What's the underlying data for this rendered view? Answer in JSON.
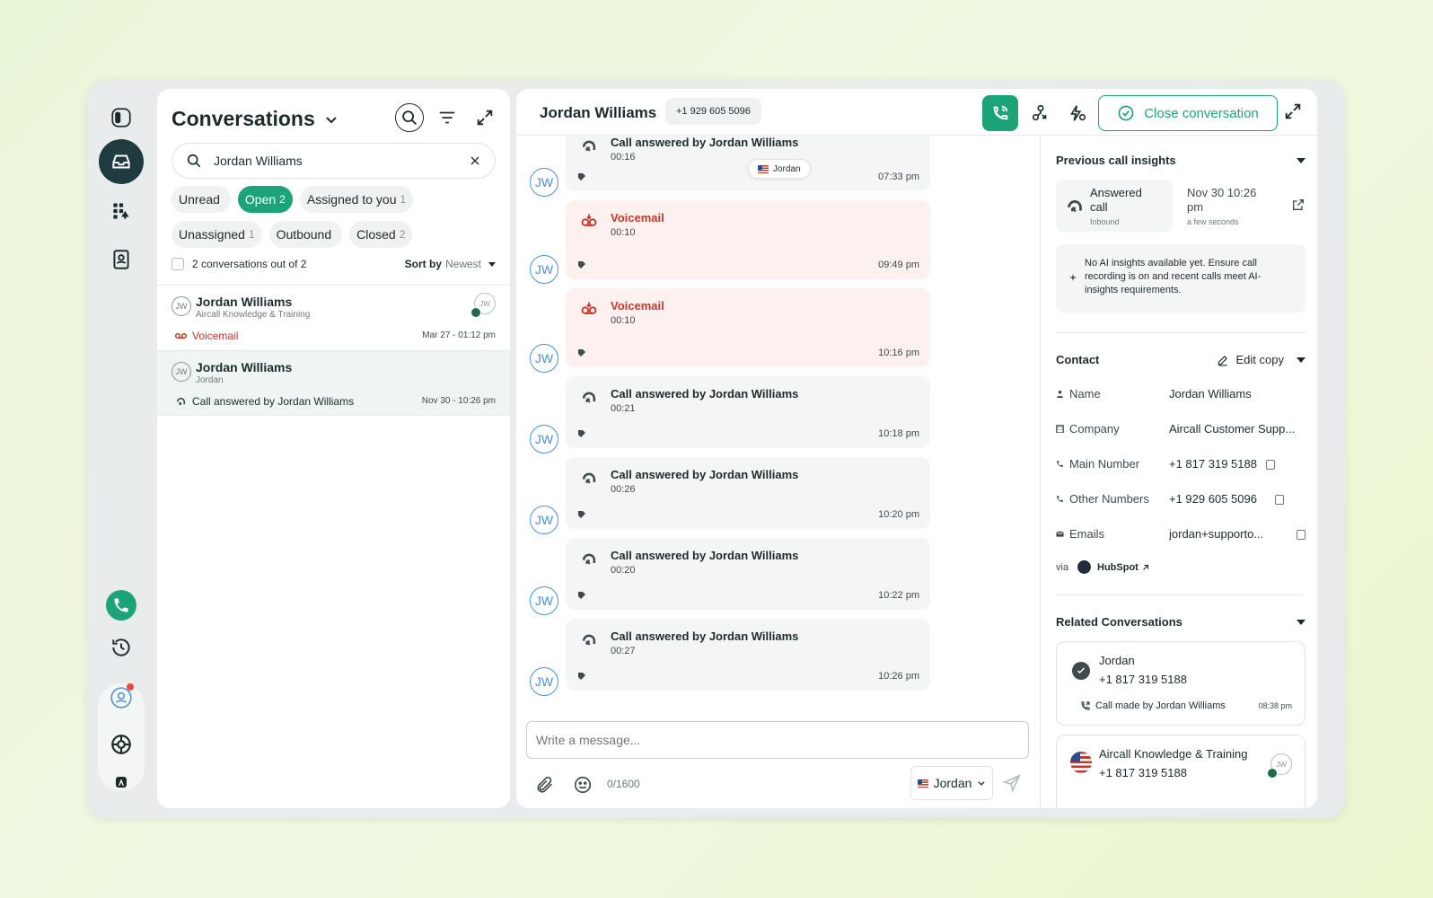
{
  "rail": {
    "icons": [
      "sidebar-toggle-icon",
      "inbox-icon",
      "dialpad-icon",
      "contacts-icon",
      "phone-icon",
      "history-icon",
      "user-icon",
      "help-icon",
      "app-icon"
    ]
  },
  "conversations": {
    "title": "Conversations",
    "search_value": "Jordan Williams",
    "search_placeholder": "Search",
    "filters": [
      {
        "label": "Unread",
        "count": ""
      },
      {
        "label": "Open",
        "count": "2"
      },
      {
        "label": "Assigned to you",
        "count": "1"
      },
      {
        "label": "Unassigned",
        "count": "1"
      },
      {
        "label": "Outbound",
        "count": ""
      },
      {
        "label": "Closed",
        "count": "2"
      }
    ],
    "count_text": "2 conversations out of 2",
    "sort_label": "Sort by",
    "sort_value": "Newest",
    "items": [
      {
        "initials": "JW",
        "name": "Jordan Williams",
        "sub": "Aircall Knowledge & Training",
        "last": "Voicemail",
        "time": "Mar 27 - 01:12 pm",
        "owner": "JW"
      },
      {
        "initials": "JW",
        "name": "Jordan Williams",
        "sub": "Jordan",
        "last": "Call answered by Jordan Williams",
        "time": "Nov 30 - 10:26 pm"
      }
    ]
  },
  "chat": {
    "contact_name": "Jordan Williams",
    "phone": "+1 929 605 5096",
    "close_label": "Close conversation",
    "line_pill": "Jordan",
    "messages": [
      {
        "type": "answered",
        "title": "Call answered by Jordan Williams",
        "duration": "00:16",
        "time": "07:33 pm"
      },
      {
        "type": "voicemail",
        "title": "Voicemail",
        "duration": "00:10",
        "time": "09:49 pm"
      },
      {
        "type": "voicemail",
        "title": "Voicemail",
        "duration": "00:10",
        "time": "10:16 pm"
      },
      {
        "type": "answered",
        "title": "Call answered by Jordan Williams",
        "duration": "00:21",
        "time": "10:18 pm"
      },
      {
        "type": "answered",
        "title": "Call answered by Jordan Williams",
        "duration": "00:26",
        "time": "10:20 pm"
      },
      {
        "type": "answered",
        "title": "Call answered by Jordan Williams",
        "duration": "00:20",
        "time": "10:22 pm"
      },
      {
        "type": "answered",
        "title": "Call answered by Jordan Williams",
        "duration": "00:27",
        "time": "10:26 pm"
      }
    ],
    "avatar_initials": "JW",
    "composer_placeholder": "Write a message...",
    "char_count": "0/1600",
    "line_select": "Jordan"
  },
  "insights": {
    "title": "Previous call insights",
    "call_status": "Answered call",
    "call_direction": "Inbound",
    "call_date": "Nov 30 10:26 pm",
    "call_ago": "a few seconds",
    "ai_note": "No AI insights available yet. Ensure call recording is on and recent calls meet AI-insights requirements."
  },
  "contact": {
    "title": "Contact",
    "edit_label": "Edit copy",
    "fields": [
      {
        "label": "Name",
        "value": "Jordan Williams"
      },
      {
        "label": "Company",
        "value": "Aircall Customer Supp..."
      },
      {
        "label": "Main Number",
        "value": "+1 817 319 5188"
      },
      {
        "label": "Other Numbers",
        "value": "+1 929 605 5096"
      },
      {
        "label": "Emails",
        "value": "jordan+supporto..."
      }
    ],
    "via_label": "via",
    "via_source": "HubSpot"
  },
  "related": {
    "title": "Related Conversations",
    "items": [
      {
        "name": "Jordan",
        "phone": "+1 817 319 5188",
        "last": "Call made by Jordan Williams",
        "time": "08:38 pm"
      },
      {
        "name": "Aircall Knowledge & Training",
        "phone": "+1 817 319 5188",
        "owner": "JW"
      }
    ]
  },
  "colors": {
    "accent": "#1ca478",
    "voicemail": "#c0392b",
    "rail_active": "#1f3b3f",
    "avatar_blue": "#4a90d9"
  }
}
